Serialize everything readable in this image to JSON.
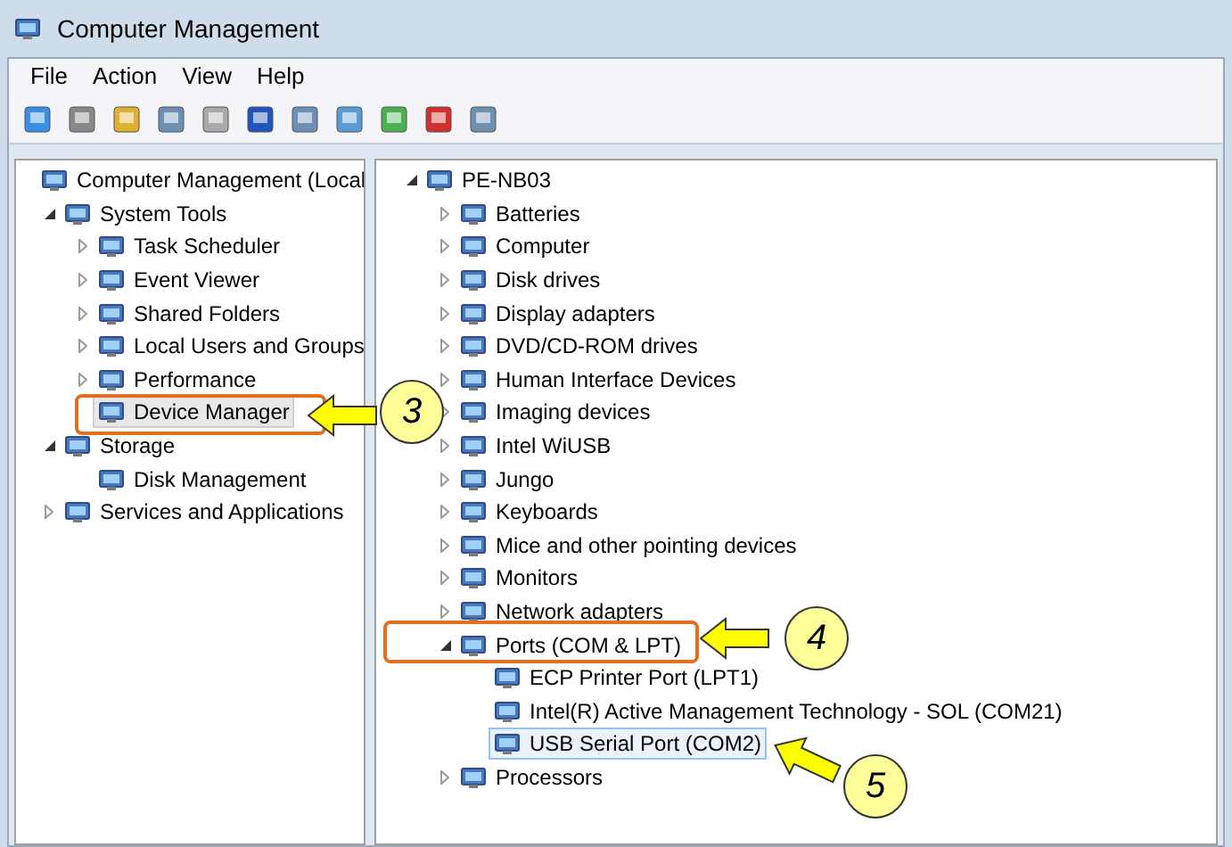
{
  "window": {
    "title": "Computer Management"
  },
  "menu": [
    "File",
    "Action",
    "View",
    "Help"
  ],
  "left_tree": [
    {
      "label": "Computer Management (Local",
      "selected": false,
      "children": [
        {
          "label": "System Tools",
          "expanded": true,
          "selected": false,
          "children": [
            {
              "label": "Task Scheduler",
              "expanded": false,
              "selected": false
            },
            {
              "label": "Event Viewer",
              "expanded": false,
              "selected": false
            },
            {
              "label": "Shared Folders",
              "expanded": false,
              "selected": false
            },
            {
              "label": "Local Users and Groups",
              "expanded": false,
              "selected": false
            },
            {
              "label": "Performance",
              "expanded": false,
              "selected": false
            },
            {
              "label": "Device Manager",
              "selected": true
            }
          ]
        },
        {
          "label": "Storage",
          "expanded": true,
          "selected": false,
          "children": [
            {
              "label": "Disk Management",
              "selected": false
            }
          ]
        },
        {
          "label": "Services and Applications",
          "expanded": false,
          "selected": false
        }
      ]
    }
  ],
  "right_tree": [
    {
      "label": "PE-NB03",
      "expanded": true,
      "selected": false,
      "children": [
        {
          "label": "Batteries",
          "expanded": false,
          "selected": false
        },
        {
          "label": "Computer",
          "expanded": false,
          "selected": false
        },
        {
          "label": "Disk drives",
          "expanded": false,
          "selected": false
        },
        {
          "label": "Display adapters",
          "expanded": false,
          "selected": false
        },
        {
          "label": "DVD/CD-ROM drives",
          "expanded": false,
          "selected": false
        },
        {
          "label": "Human Interface Devices",
          "expanded": false,
          "selected": false
        },
        {
          "label": "Imaging devices",
          "expanded": false,
          "selected": false
        },
        {
          "label": "Intel WiUSB",
          "expanded": false,
          "selected": false
        },
        {
          "label": "Jungo",
          "expanded": false,
          "selected": false
        },
        {
          "label": "Keyboards",
          "expanded": false,
          "selected": false
        },
        {
          "label": "Mice and other pointing devices",
          "expanded": false,
          "selected": false
        },
        {
          "label": "Monitors",
          "expanded": false,
          "selected": false
        },
        {
          "label": "Network adapters",
          "expanded": false,
          "selected": false
        },
        {
          "label": "Ports (COM & LPT)",
          "expanded": true,
          "selected": false,
          "children": [
            {
              "label": "ECP Printer Port (LPT1)",
              "selected": false
            },
            {
              "label": "Intel(R) Active Management Technology - SOL (COM21)",
              "selected": false
            },
            {
              "label": "USB Serial Port (COM2)",
              "selected": true
            }
          ]
        },
        {
          "label": "Processors",
          "expanded": false,
          "selected": false
        }
      ]
    }
  ],
  "callouts": [
    "3",
    "4",
    "5"
  ]
}
